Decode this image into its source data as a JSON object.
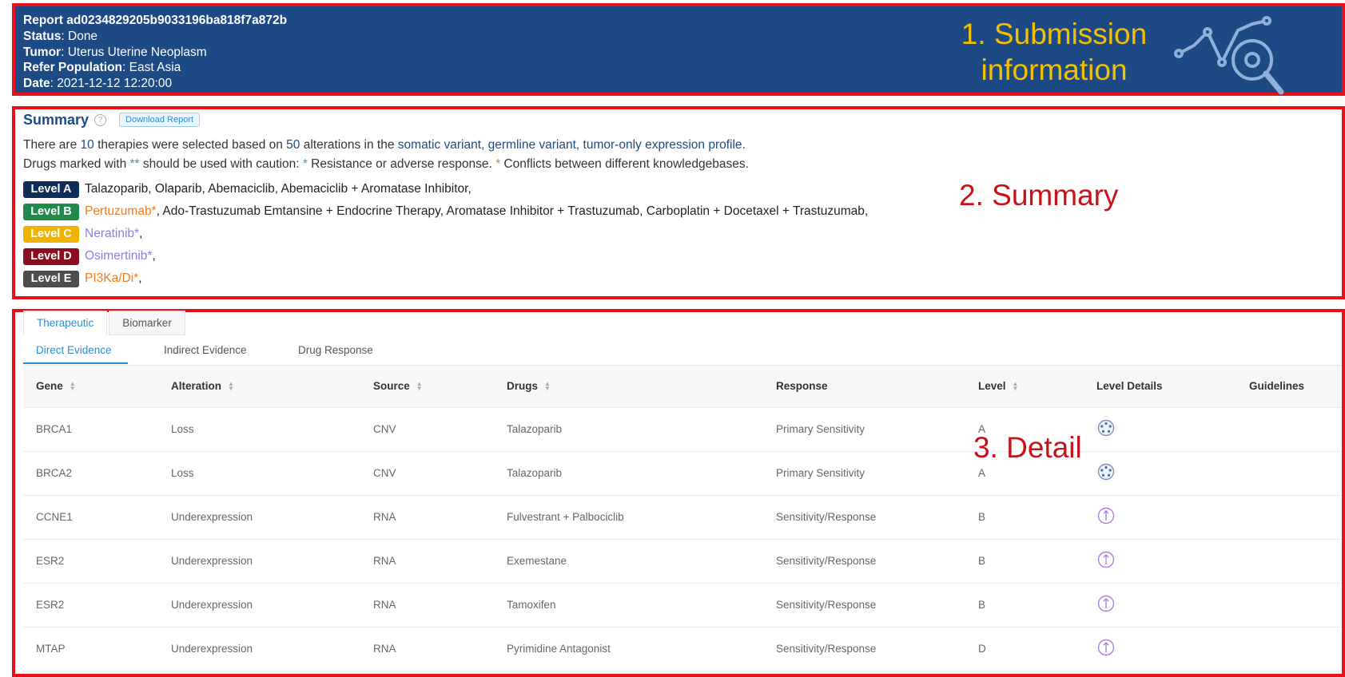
{
  "submission": {
    "report_id": "Report ad0234829205b9033196ba818f7a872b",
    "status_label": "Status",
    "status_value": "Done",
    "tumor_label": "Tumor",
    "tumor_value": "Uterus Uterine Neoplasm",
    "population_label": "Refer Population",
    "population_value": "East Asia",
    "date_label": "Date",
    "date_value": "2021-12-12 12:20:00",
    "section_title": "1. Submission information",
    "icon": "chart-magnifier-icon"
  },
  "summary": {
    "title": "Summary",
    "help_icon": "?",
    "download_label": "Download Report",
    "line1": {
      "p1": "There are ",
      "therapies": "10",
      "p2": " therapies were selected based on ",
      "alterations": "50",
      "p3": " alterations in the ",
      "link1": "somatic variant",
      "sep1": ", ",
      "link2": "germline variant",
      "sep2": ", ",
      "link3": "tumor-only expression profile",
      "p4": "."
    },
    "line2": {
      "p1": "Drugs marked with ",
      "marker": "**",
      "p2": " should be used with caution: ",
      "star1": "*",
      "p3": " Resistance or adverse response. ",
      "star2": "*",
      "p4": " Conflicts between different knowledgebases."
    },
    "levels": [
      {
        "label": "Level A",
        "color": "#0f2e57",
        "drugs": "Talazoparib, Olaparib, Abemaciclib, Abemaciclib + Aromatase Inhibitor,"
      },
      {
        "label": "Level B",
        "color": "#1f8a4c",
        "drug_hl": "Pertuzumab*",
        "drugs": ", Ado-Trastuzumab Emtansine + Endocrine Therapy, Aromatase Inhibitor + Trastuzumab, Carboplatin + Docetaxel + Trastuzumab,"
      },
      {
        "label": "Level C",
        "color": "#f0b400",
        "drug_hl": "Neratinib*",
        "drugs": ","
      },
      {
        "label": "Level D",
        "color": "#8b0d1e",
        "drug_hl": "Osimertinib*",
        "drugs": ","
      },
      {
        "label": "Level E",
        "color": "#4d4d4d",
        "drug_hl": "PI3Ka/Di*",
        "drugs": ","
      }
    ],
    "section_title": "2. Summary"
  },
  "detail": {
    "tabs": [
      "Therapeutic",
      "Biomarker"
    ],
    "subtabs": [
      "Direct Evidence",
      "Indirect Evidence",
      "Drug Response"
    ],
    "columns": [
      "Gene",
      "Alteration",
      "Source",
      "Drugs",
      "Response",
      "Level",
      "Level Details",
      "Guidelines"
    ],
    "rows": [
      {
        "gene": "BRCA1",
        "alteration": "Loss",
        "source": "CNV",
        "drugs": "Talazoparib",
        "response": "Primary Sensitivity",
        "level": "A",
        "icon": "cluster-icon"
      },
      {
        "gene": "BRCA2",
        "alteration": "Loss",
        "source": "CNV",
        "drugs": "Talazoparib",
        "response": "Primary Sensitivity",
        "level": "A",
        "icon": "cluster-icon"
      },
      {
        "gene": "CCNE1",
        "alteration": "Underexpression",
        "source": "RNA",
        "drugs": "Fulvestrant + Palbociclib",
        "response": "Sensitivity/Response",
        "level": "B",
        "icon": "arrow-circle-icon"
      },
      {
        "gene": "ESR2",
        "alteration": "Underexpression",
        "source": "RNA",
        "drugs": "Exemestane",
        "response": "Sensitivity/Response",
        "level": "B",
        "icon": "arrow-circle-icon"
      },
      {
        "gene": "ESR2",
        "alteration": "Underexpression",
        "source": "RNA",
        "drugs": "Tamoxifen",
        "response": "Sensitivity/Response",
        "level": "B",
        "icon": "arrow-circle-icon"
      },
      {
        "gene": "MTAP",
        "alteration": "Underexpression",
        "source": "RNA",
        "drugs": "Pyrimidine Antagonist",
        "response": "Sensitivity/Response",
        "level": "D",
        "icon": "arrow-circle-icon"
      }
    ],
    "section_title": "3. Detail"
  }
}
